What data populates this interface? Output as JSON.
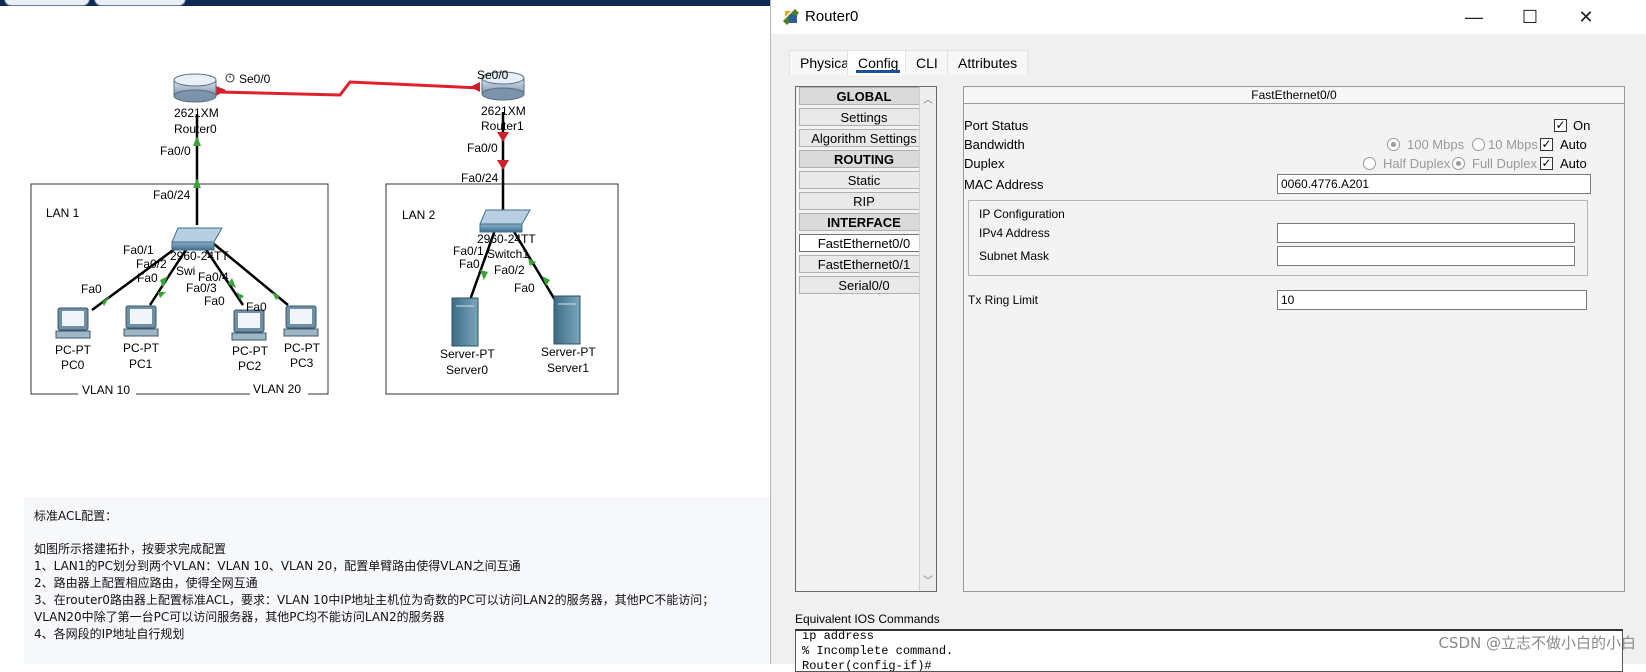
{
  "topology": {
    "devices": {
      "router0": {
        "model": "2621XM",
        "name": "Router0"
      },
      "router1": {
        "model": "2621XM",
        "name": "Router1"
      },
      "switch0": {
        "model": "2960-24TT",
        "name": "Swi"
      },
      "switch1": {
        "model": "2960-24TT",
        "name": "Switch1"
      },
      "pc0": {
        "type": "PC-PT",
        "name": "PC0"
      },
      "pc1": {
        "type": "PC-PT",
        "name": "PC1"
      },
      "pc2": {
        "type": "PC-PT",
        "name": "PC2"
      },
      "pc3": {
        "type": "PC-PT",
        "name": "PC3"
      },
      "server0": {
        "type": "Server-PT",
        "name": "Server0"
      },
      "server1": {
        "type": "Server-PT",
        "name": "Server1"
      }
    },
    "ports": {
      "r0_se": "Se0/0",
      "r1_se": "Se0/0",
      "r0_fa": "Fa0/0",
      "r1_fa": "Fa0/0",
      "sw0_up": "Fa0/24",
      "sw1_up": "Fa0/24",
      "sw0_p1": "Fa0/1",
      "sw0_p2": "Fa0/2",
      "sw0_p3": "Fa0/3",
      "sw0_p4": "Fa0/4",
      "sw1_p1": "Fa0/1",
      "sw1_p2": "Fa0/2",
      "pc0": "Fa0",
      "pc1": "Fa0",
      "pc2": "Fa0",
      "pc3": "Fa0",
      "server0": "Fa0",
      "server1": "Fa0"
    },
    "areas": {
      "lan1": "LAN 1",
      "lan2": "LAN 2",
      "vlan10": "VLAN 10",
      "vlan20": "VLAN 20"
    }
  },
  "notes": {
    "heading": "标准ACL配置：",
    "lines": [
      "如图所示搭建拓扑，按要求完成配置",
      "1、LAN1的PC划分到两个VLAN：VLAN 10、VLAN 20，配置单臂路由使得VLAN之间互通",
      "2、路由器上配置相应路由，使得全网互通",
      "3、在router0路由器上配置标准ACL，要求：VLAN 10中IP地址主机位为奇数的PC可以访问LAN2的服务器，其他PC不能访问；",
      "VLAN20中除了第一台PC可以访问服务器，其他PC均不能访问LAN2的服务器",
      "4、各网段的IP地址自行规划"
    ]
  },
  "window": {
    "title": "Router0",
    "controls": {
      "minimize": "—",
      "maximize": "☐",
      "close": "✕"
    },
    "tabs": [
      "Physical",
      "Config",
      "CLI",
      "Attributes"
    ],
    "active_tab": "Config",
    "sidebar": [
      {
        "label": "GLOBAL",
        "kind": "header"
      },
      {
        "label": "Settings",
        "kind": "item"
      },
      {
        "label": "Algorithm Settings",
        "kind": "item"
      },
      {
        "label": "ROUTING",
        "kind": "header"
      },
      {
        "label": "Static",
        "kind": "item"
      },
      {
        "label": "RIP",
        "kind": "item"
      },
      {
        "label": "INTERFACE",
        "kind": "header"
      },
      {
        "label": "FastEthernet0/0",
        "kind": "selected"
      },
      {
        "label": "FastEthernet0/1",
        "kind": "item"
      },
      {
        "label": "Serial0/0",
        "kind": "item"
      }
    ],
    "panel": {
      "title": "FastEthernet0/0",
      "port_status": {
        "label": "Port Status",
        "on_label": "On",
        "on": true
      },
      "bandwidth": {
        "label": "Bandwidth",
        "opt100": "100 Mbps",
        "opt10": "10 Mbps",
        "auto_label": "Auto",
        "auto": true
      },
      "duplex": {
        "label": "Duplex",
        "half": "Half Duplex",
        "full": "Full Duplex",
        "auto_label": "Auto",
        "auto": true
      },
      "mac": {
        "label": "MAC Address",
        "value": "0060.4776.A201"
      },
      "ip_config": {
        "label": "IP Configuration",
        "ipv4_label": "IPv4 Address",
        "ipv4_value": "",
        "mask_label": "Subnet Mask",
        "mask_value": ""
      },
      "tx_ring": {
        "label": "Tx Ring Limit",
        "value": "10"
      }
    },
    "ios": {
      "label": "Equivalent IOS Commands",
      "lines": [
        "ip address",
        "% Incomplete command.",
        "Router(config-if)#"
      ]
    }
  },
  "watermark": "CSDN @立志不做小白的小白",
  "colors": {
    "serial_link": "#e0202a",
    "link": "#000000",
    "port_up": "#3aa335",
    "port_down": "#d11f2a",
    "accent": "#1a4fa0"
  }
}
